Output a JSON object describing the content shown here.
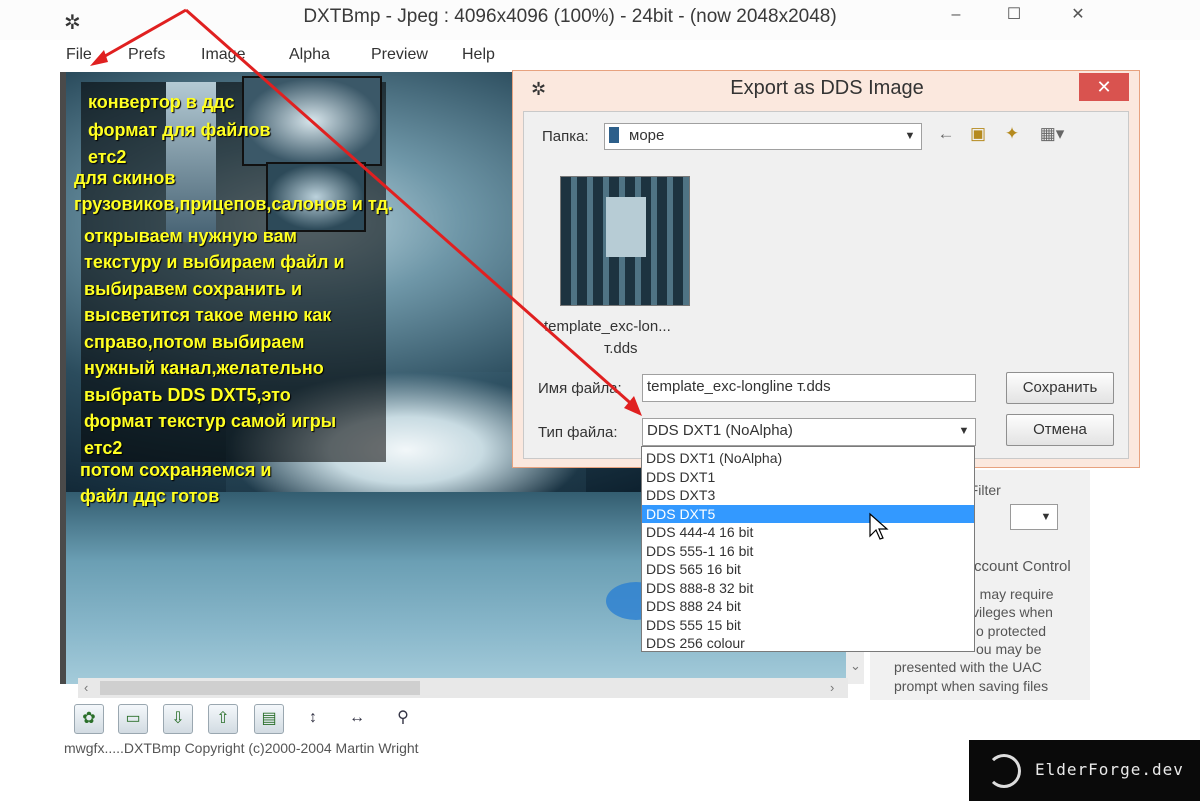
{
  "window": {
    "title": "DXTBmp - Jpeg : 4096x4096 (100%) - 24bit - (now 2048x2048)",
    "controls": [
      "–",
      "☐",
      "✕"
    ]
  },
  "menu": [
    "File",
    "Prefs",
    "Image",
    "Alpha",
    "Preview",
    "Help"
  ],
  "notes": [
    "конвертор в ддс",
    "формат для файлов",
    "етс2",
    "для скинов",
    "грузовиков,прицепов,салонов и тд.",
    "открываем нужную вам",
    "текстуру и выбираем файл и",
    "выбиравем сохранить и",
    "высветится такое меню как",
    "справо,потом выбираем",
    "нужный канал,желательно",
    "выбрать DDS DXT5,это",
    "формат текстур самой игры",
    "етс2",
    "потом сохраняемся и",
    "файл ддс готов"
  ],
  "dialog": {
    "title": "Export as DDS Image",
    "folder_label": "Папка:",
    "folder_value": "море",
    "thumb_caption_1": "template_exc-lon...",
    "thumb_caption_2": "т.dds",
    "filename_label": "Имя файла:",
    "filename_value": "template_exc-longline т.dds",
    "filetype_label": "Тип файла:",
    "filetype_value": "DDS DXT1 (NoAlpha)",
    "save_label": "Сохранить",
    "cancel_label": "Отмена"
  },
  "filetype_options": [
    "DDS DXT1 (NoAlpha)",
    "DDS DXT1",
    "DDS DXT3",
    "DDS DXT5",
    "DDS 444-4 16 bit",
    "DDS 555-1 16 bit",
    "DDS 565 16 bit",
    "DDS 888-8 32 bit",
    "DDS 888 24 bit",
    "DDS 555 15 bit",
    "DDS 256 colour"
  ],
  "highlighted_option": "DDS DXT5",
  "right_panel": {
    "filter_label": "g Filter",
    "uac_title": "ccount Control",
    "uac_lines": [
      "n may require",
      "vileges when",
      "o protected",
      "ou may be",
      "presented with the UAC",
      "prompt when saving files"
    ]
  },
  "status": "mwgfx.....DXTBmp Copyright (c)2000-2004 Martin Wright",
  "watermark": "ElderForge.dev",
  "colors": {
    "note_text": "#ffff22",
    "annotation_arrow": "#e02020",
    "selection": "#3399ff"
  }
}
